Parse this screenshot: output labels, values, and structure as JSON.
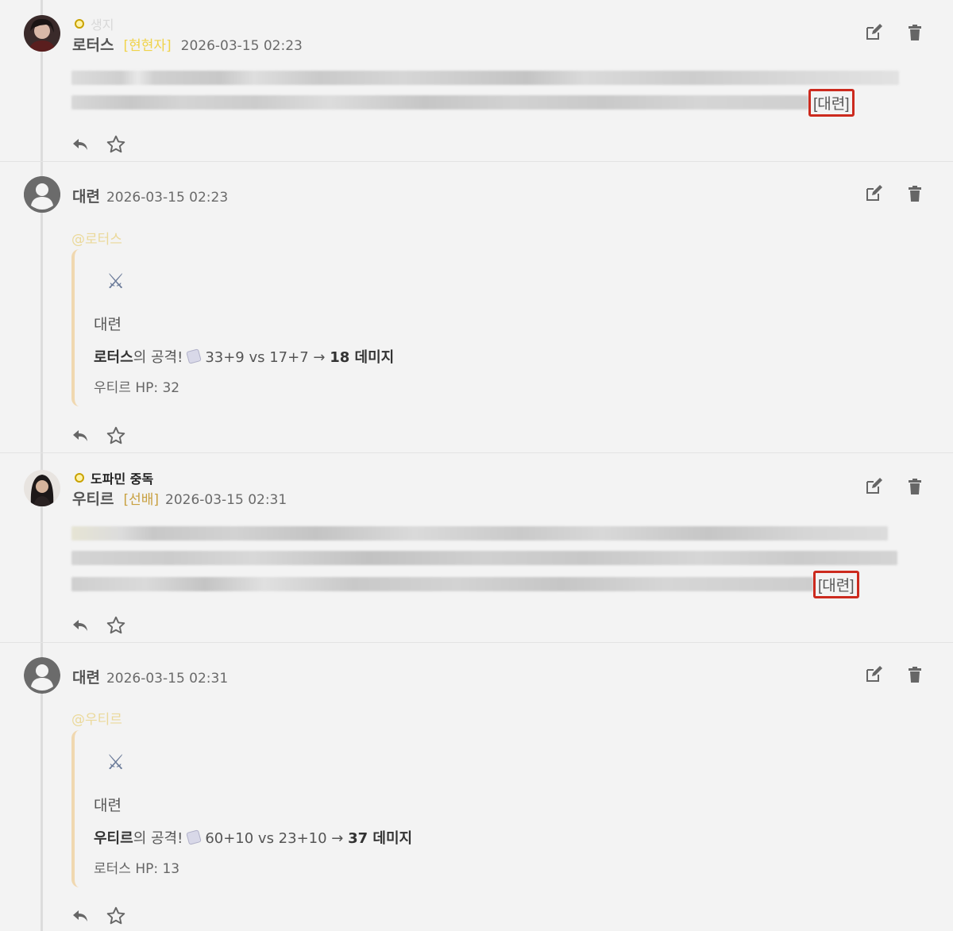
{
  "comments": [
    {
      "badge_text": "생지",
      "author": "로터스",
      "tag": "[현현자]",
      "timestamp": "2026-03-15 02:23",
      "boxed_tag": "[대련]"
    },
    {
      "author": "대련",
      "timestamp": "2026-03-15 02:23",
      "mention": "@로터스",
      "quote": {
        "title": "대련",
        "attacker": "로터스",
        "attack_suffix": "의 공격!",
        "roll": "33+9 vs 17+7 →",
        "damage": "18 데미지",
        "hp": "우티르 HP: 32"
      }
    },
    {
      "badge_text": "도파민 중독",
      "author": "우티르",
      "tag": "[선배]",
      "timestamp": "2026-03-15 02:31",
      "boxed_tag": "[대련]"
    },
    {
      "author": "대련",
      "timestamp": "2026-03-15 02:31",
      "mention": "@우티르",
      "quote": {
        "title": "대련",
        "attacker": "우티르",
        "attack_suffix": "의 공격!",
        "roll": "60+10 vs 23+10 →",
        "damage": "37 데미지",
        "hp": "로터스 HP: 13"
      }
    }
  ],
  "icons": {
    "edit": "edit-icon",
    "delete": "trash-icon",
    "reply": "reply-icon",
    "favorite": "star-icon",
    "swords": "crossed-swords-icon",
    "dice": "dice-icon"
  },
  "colors": {
    "highlight_border": "#cc2a1e",
    "quote_border": "#f0d8b0",
    "tag_yellow": "#f0d34a",
    "tag_gold": "#c8a040"
  }
}
